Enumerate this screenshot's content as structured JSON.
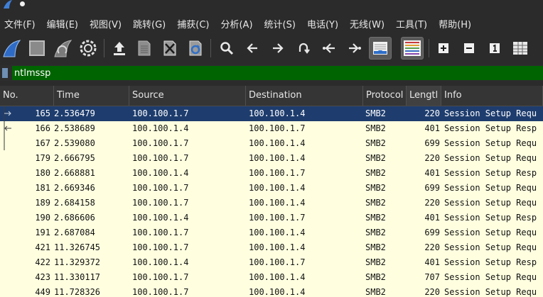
{
  "menu": [
    "文件(F)",
    "编辑(E)",
    "视图(V)",
    "跳转(G)",
    "捕获(C)",
    "分析(A)",
    "统计(S)",
    "电话(Y)",
    "无线(W)",
    "工具(T)",
    "帮助(H)"
  ],
  "toolbar": {
    "icons": [
      "start-capture-icon",
      "stop-capture-icon",
      "restart-capture-icon",
      "capture-options-icon",
      "open-file-icon",
      "save-file-icon",
      "close-file-icon",
      "reload-file-icon",
      "find-packet-icon",
      "go-back-icon",
      "go-forward-icon",
      "go-to-packet-icon",
      "go-first-packet-icon",
      "go-last-packet-icon",
      "auto-scroll-icon",
      "colorize-icon",
      "zoom-in-icon",
      "zoom-out-icon",
      "normal-size-icon",
      "resize-columns-icon"
    ]
  },
  "filter": {
    "value": "ntlmssp"
  },
  "columns": [
    "No.",
    "Time",
    "Source",
    "Destination",
    "Protocol",
    "Lengtl",
    "Info"
  ],
  "packets": [
    [
      "165",
      "2.536479",
      "100.100.1.7",
      "100.100.1.4",
      "SMB2",
      "220",
      "Session Setup Requ"
    ],
    [
      "166",
      "2.538689",
      "100.100.1.4",
      "100.100.1.7",
      "SMB2",
      "401",
      "Session Setup Resp"
    ],
    [
      "167",
      "2.539080",
      "100.100.1.7",
      "100.100.1.4",
      "SMB2",
      "699",
      "Session Setup Requ"
    ],
    [
      "179",
      "2.666795",
      "100.100.1.7",
      "100.100.1.4",
      "SMB2",
      "220",
      "Session Setup Requ"
    ],
    [
      "180",
      "2.668881",
      "100.100.1.4",
      "100.100.1.7",
      "SMB2",
      "401",
      "Session Setup Resp"
    ],
    [
      "181",
      "2.669346",
      "100.100.1.7",
      "100.100.1.4",
      "SMB2",
      "699",
      "Session Setup Requ"
    ],
    [
      "189",
      "2.684158",
      "100.100.1.7",
      "100.100.1.4",
      "SMB2",
      "220",
      "Session Setup Requ"
    ],
    [
      "190",
      "2.686606",
      "100.100.1.4",
      "100.100.1.7",
      "SMB2",
      "401",
      "Session Setup Resp"
    ],
    [
      "191",
      "2.687084",
      "100.100.1.7",
      "100.100.1.4",
      "SMB2",
      "699",
      "Session Setup Requ"
    ],
    [
      "421",
      "11.326745",
      "100.100.1.7",
      "100.100.1.4",
      "SMB2",
      "220",
      "Session Setup Requ"
    ],
    [
      "422",
      "11.329372",
      "100.100.1.4",
      "100.100.1.7",
      "SMB2",
      "401",
      "Session Setup Resp"
    ],
    [
      "423",
      "11.330117",
      "100.100.1.7",
      "100.100.1.4",
      "SMB2",
      "707",
      "Session Setup Requ"
    ],
    [
      "449",
      "11.728326",
      "100.100.1.7",
      "100.100.1.4",
      "SMB2",
      "220",
      "Session Setup Requ"
    ]
  ],
  "selected_packet": "165",
  "colors": {
    "filter_valid": "#006400",
    "row_bg": "#ffffe0",
    "selected_bg": "#1e3d6e"
  }
}
